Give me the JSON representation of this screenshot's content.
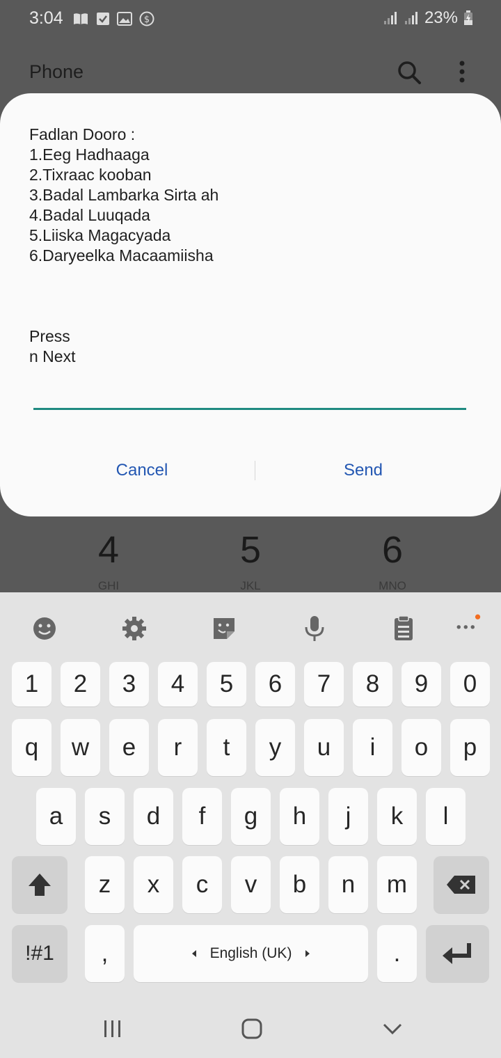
{
  "status_bar": {
    "time": "3:04",
    "battery": "23%"
  },
  "app_bar": {
    "title": "Phone"
  },
  "dialer_keys": [
    {
      "num": "4",
      "letters": "GHI"
    },
    {
      "num": "5",
      "letters": "JKL"
    },
    {
      "num": "6",
      "letters": "MNO"
    }
  ],
  "dialog": {
    "message": "Fadlan Dooro :\n1.Eeg Hadhaaga\n2.Tixraac kooban\n3.Badal Lambarka Sirta ah\n4.Badal Luuqada\n5.Liiska Magacyada\n6.Daryeelka Macaamiisha\n\n\n\nPress\nn Next",
    "input_value": "",
    "cancel_label": "Cancel",
    "send_label": "Send"
  },
  "keyboard": {
    "row_numbers": [
      "1",
      "2",
      "3",
      "4",
      "5",
      "6",
      "7",
      "8",
      "9",
      "0"
    ],
    "row_top": [
      "q",
      "w",
      "e",
      "r",
      "t",
      "y",
      "u",
      "i",
      "o",
      "p"
    ],
    "row_mid": [
      "a",
      "s",
      "d",
      "f",
      "g",
      "h",
      "j",
      "k",
      "l"
    ],
    "row_bottom": [
      "z",
      "x",
      "c",
      "v",
      "b",
      "n",
      "m"
    ],
    "symbols_label": "!#1",
    "comma_label": ",",
    "space_label": "English (UK)",
    "period_label": ".",
    "colors": {
      "background": "#e3e3e3",
      "key": "#fbfbfb",
      "function_key": "#d1d1d1",
      "accent_dot": "#f26d21"
    }
  }
}
